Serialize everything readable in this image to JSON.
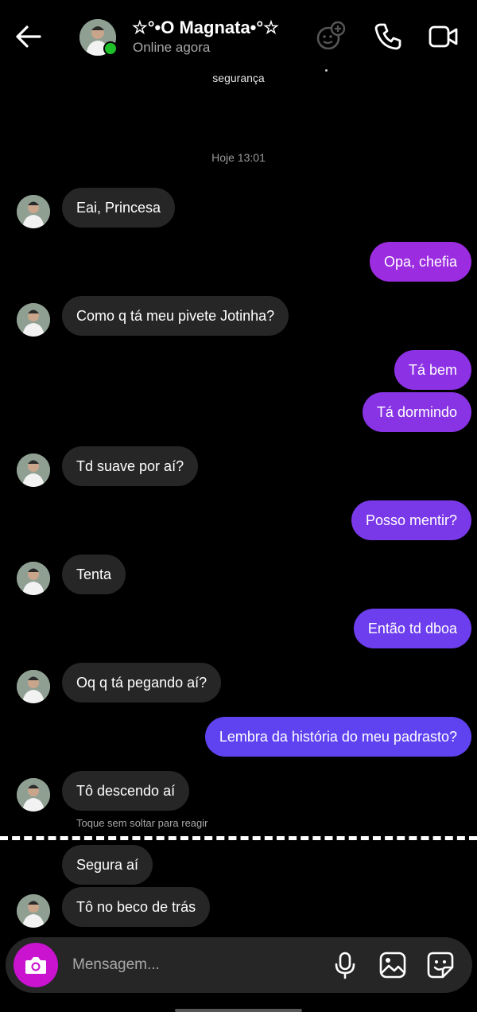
{
  "header": {
    "contact_name": "☆°•O Magnata•°☆",
    "status": "Online agora"
  },
  "banner_text": "segurança",
  "timestamp": "Hoje 13:01",
  "messages": [
    {
      "text": "Eai, Princesa",
      "from": "them"
    },
    {
      "text": "Opa, chefia",
      "from": "me"
    },
    {
      "text": "Como q tá meu pivete Jotinha?",
      "from": "them"
    },
    {
      "text": "Tá bem",
      "from": "me"
    },
    {
      "text": "Tá dormindo",
      "from": "me"
    },
    {
      "text": "Td suave por aí?",
      "from": "them"
    },
    {
      "text": "Posso mentir?",
      "from": "me"
    },
    {
      "text": "Tenta",
      "from": "them"
    },
    {
      "text": "Então td dboa",
      "from": "me"
    },
    {
      "text": "Oq q tá pegando aí?",
      "from": "them"
    },
    {
      "text": "Lembra da história do meu padrasto?",
      "from": "me"
    },
    {
      "text": "Tô descendo aí",
      "from": "them"
    },
    {
      "text": "Segura aí",
      "from": "them"
    },
    {
      "text": "Tô  no beco de trás",
      "from": "them"
    }
  ],
  "react_hint": "Toque sem soltar para reagir",
  "composer": {
    "placeholder": "Mensagem..."
  },
  "colors": {
    "background": "#000000",
    "incoming_bubble": "#262626",
    "outgoing_gradient_start": "#9b2ce0",
    "outgoing_gradient_end": "#5b45f2",
    "camera_button": "#c913cf",
    "online_dot": "#1fc12b"
  }
}
